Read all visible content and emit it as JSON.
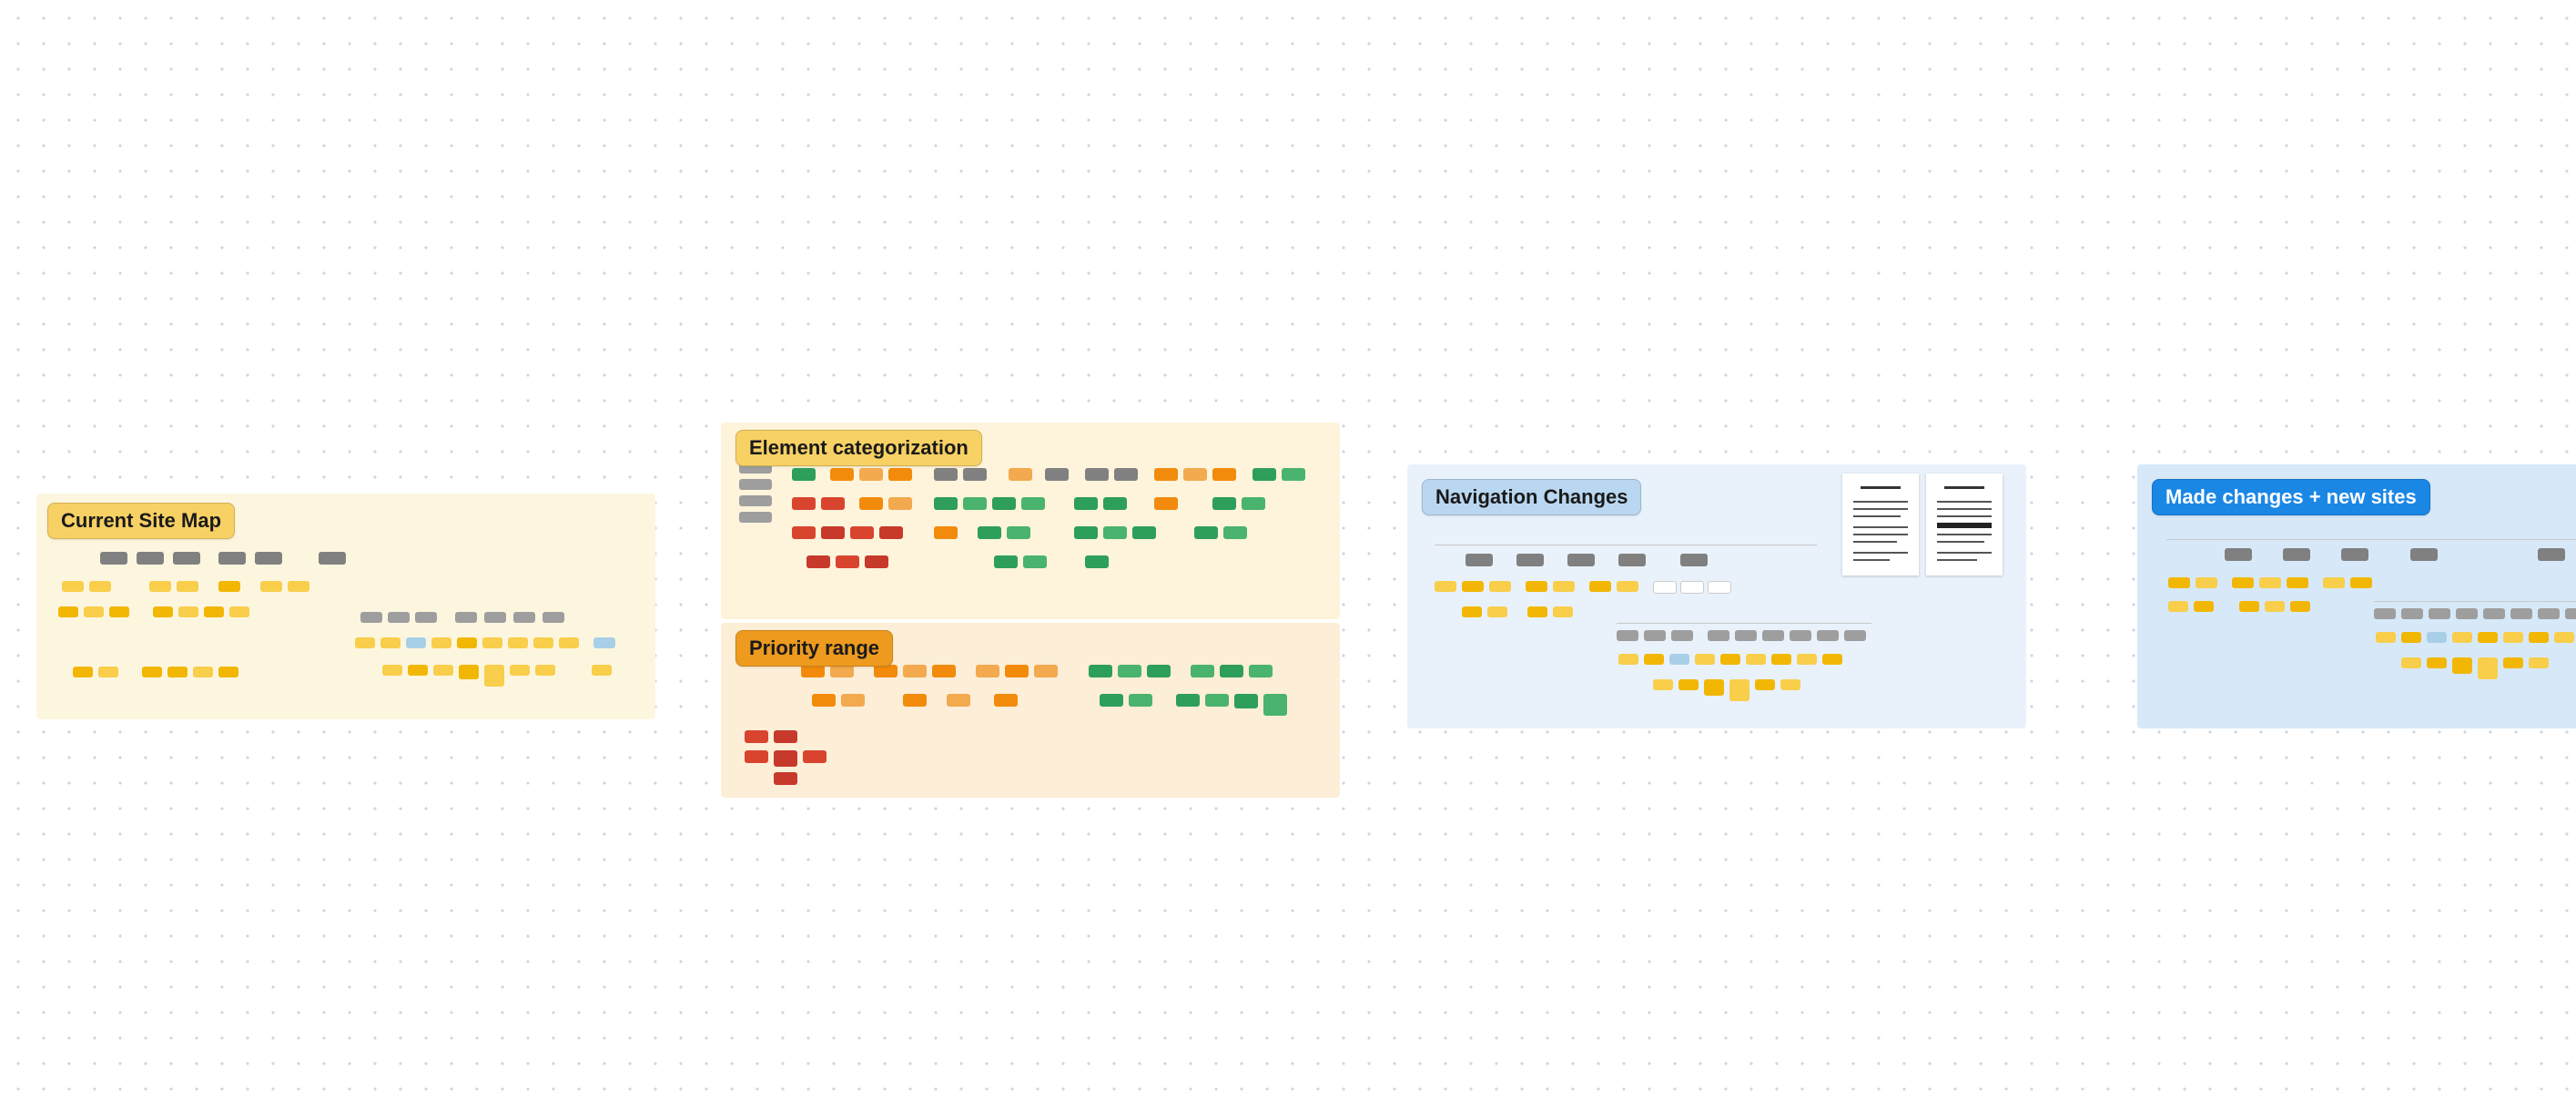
{
  "sections": {
    "currentSiteMap": {
      "label": "Current Site Map",
      "label_bg": "#f7d164",
      "label_fg": "#1a1a1a",
      "frame_bg": "#fdf6df"
    },
    "elementCategorization": {
      "label": "Element categorization",
      "label_bg": "#f7d164",
      "label_fg": "#1a1a1a",
      "frame_bg": "#fdf4db"
    },
    "priorityRange": {
      "label": "Priority range",
      "label_bg": "#ed9a1f",
      "label_fg": "#1a1a1a",
      "frame_bg": "#fdeed7"
    },
    "navigationChanges": {
      "label": "Navigation Changes",
      "label_bg": "#b9d7f0",
      "label_fg": "#1a1a1a",
      "frame_bg": "#e9f2fb"
    },
    "madeChanges": {
      "label": "Made changes + new sites",
      "label_bg": "#1b87e5",
      "label_fg": "#ffffff",
      "frame_bg": "#d7e9f9"
    }
  },
  "legend_colors": {
    "gray": "#808080",
    "yellow": "#f2b705",
    "orange": "#f28b0c",
    "red": "#d9442f",
    "green": "#2e9e5b",
    "blue_light": "#a9cfe8",
    "white": "#ffffff"
  }
}
